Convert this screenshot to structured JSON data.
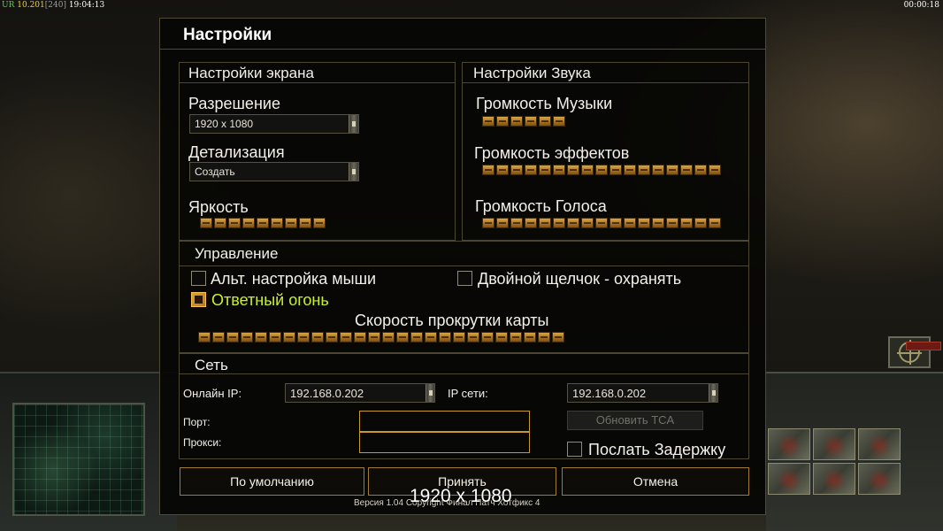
{
  "hud": {
    "prefix": "UR",
    "version": "10.201",
    "bracket": "[240]",
    "clock": "19:04:13",
    "timer": "00:00:18"
  },
  "dialog": {
    "title": "Настройки",
    "screen": {
      "title": "Настройки экрана",
      "resolution_label": "Разрешение",
      "resolution_value": "1920 x 1080",
      "detail_label": "Детализация",
      "detail_value": "Создать",
      "brightness_label": "Яркость",
      "brightness_level": 9
    },
    "sound": {
      "title": "Настройки Звука",
      "music_label": "Громкость Музыки",
      "music_level": 6,
      "effects_label": "Громкость эффектов",
      "effects_level": 17,
      "voice_label": "Громкость Голоса",
      "voice_level": 17
    },
    "control": {
      "title": "Управление",
      "alt_mouse_label": "Альт. настройка мыши",
      "alt_mouse_checked": false,
      "double_click_label": "Двойной щелчок - охранять",
      "double_click_checked": false,
      "return_fire_label": "Ответный огонь",
      "return_fire_checked": true,
      "return_fire_color": "#c8f02a",
      "scroll_speed_label": "Скорость прокрутки карты",
      "scroll_speed_level": 26
    },
    "network": {
      "title": "Сеть",
      "online_ip_label": "Онлайн IP:",
      "online_ip_value": "192.168.0.202",
      "net_ip_label": "IP сети:",
      "net_ip_value": "192.168.0.202",
      "port_label": "Порт:",
      "port_value": "",
      "proxy_label": "Прокси:",
      "proxy_value": "",
      "update_tca_label": "Обновить TCA",
      "send_delay_label": "Послать Задержку",
      "send_delay_checked": false
    },
    "buttons": {
      "defaults": "По умолчанию",
      "accept": "Принять",
      "cancel": "Отмена"
    },
    "version_text": "Версия 1.04 Copyright Финал Патч Хотфикс 4",
    "overlay_resolution": "1920 x 1080"
  },
  "colors": {
    "accent_gold": "#c99a2b",
    "slider_gold": "#d7a44a",
    "panel_border": "#4b4733"
  }
}
